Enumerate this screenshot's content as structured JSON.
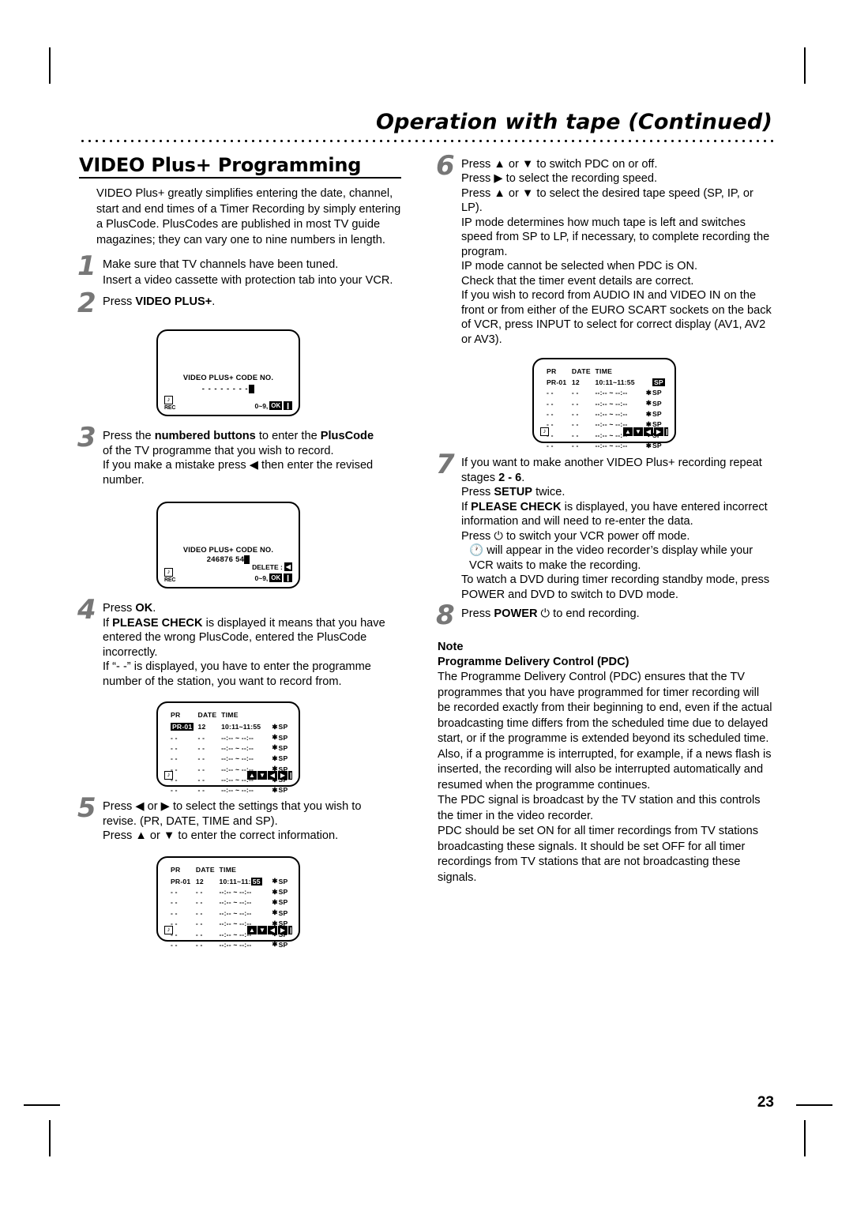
{
  "header": {
    "title": "Operation with tape (Continued)"
  },
  "page_number": "23",
  "left": {
    "section_title": "VIDEO Plus+ Programming",
    "intro": "VIDEO Plus+ greatly simplifies entering the date, channel, start and end times of a Timer Recording by simply entering a PlusCode. PlusCodes are published in most TV guide magazines; they can vary one to nine numbers in length.",
    "step1": {
      "num": "1",
      "line1": "Make sure that TV channels have been tuned.",
      "line2": "Insert a video cassette with protection tab into your VCR."
    },
    "step2": {
      "num": "2",
      "pre": "Press ",
      "bold": "VIDEO PLUS+",
      "post": "."
    },
    "screen1": {
      "title": "VIDEO PLUS+ CODE NO.",
      "dashes": "- - - - - - - -",
      "rec_label": "REC",
      "hint_prefix": "0~9,",
      "hint_key": "OK"
    },
    "step3": {
      "num": "3",
      "l1a": "Press the ",
      "l1b": "numbered buttons",
      "l1c": " to enter the ",
      "l1d": "PlusCode",
      "l2": "of the TV programme that you wish to record.",
      "l3": "If you make a mistake press ◀ then enter the revised",
      "l4": "number."
    },
    "screen2": {
      "title": "VIDEO PLUS+ CODE NO.",
      "code": "246876 54",
      "rec_label": "REC",
      "delete_label": "DELETE :",
      "hint_prefix": "0~9,",
      "hint_key": "OK"
    },
    "step4": {
      "num": "4",
      "l1a": "Press ",
      "l1b": "OK",
      "l1c": ".",
      "l2a": "If ",
      "l2b": "PLEASE CHECK",
      "l2c": " is displayed it means that you have",
      "l3": "entered the wrong PlusCode, entered the PlusCode",
      "l4": "incorrectly.",
      "l5": "If “- -” is displayed, you have to enter the programme",
      "l6": "number of the station, you want to record from."
    },
    "screen3": {
      "headers": [
        "PR",
        "DATE",
        "TIME"
      ],
      "rows": [
        {
          "pr": "PR-01",
          "pr_highlight": true,
          "date": "12",
          "time": "10:11~11:55",
          "ast": "✱",
          "sp": "SP"
        },
        {
          "pr": "- -",
          "pr_highlight": false,
          "date": "- -",
          "time": "--:-- ~ --:--",
          "ast": "✱",
          "sp": "SP"
        },
        {
          "pr": "- -",
          "pr_highlight": false,
          "date": "- -",
          "time": "--:-- ~ --:--",
          "ast": "✱",
          "sp": "SP"
        },
        {
          "pr": "- -",
          "pr_highlight": false,
          "date": "- -",
          "time": "--:-- ~ --:--",
          "ast": "✱",
          "sp": "SP"
        },
        {
          "pr": "- -",
          "pr_highlight": false,
          "date": "- -",
          "time": "--:-- ~ --:--",
          "ast": "✱",
          "sp": "SP"
        },
        {
          "pr": "- -",
          "pr_highlight": false,
          "date": "- -",
          "time": "--:-- ~ --:--",
          "ast": "✱",
          "sp": "SP"
        },
        {
          "pr": "- -",
          "pr_highlight": false,
          "date": "- -",
          "time": "--:-- ~ --:--",
          "ast": "✱",
          "sp": "SP"
        }
      ],
      "navkeys": [
        "▲",
        "▼",
        "◀",
        "▶",
        "❙"
      ]
    },
    "step5": {
      "num": "5",
      "l1": "Press ◀ or ▶ to select the settings that you wish to",
      "l2": "revise. (PR, DATE, TIME and SP).",
      "l3": "Press ▲ or ▼ to enter the correct information."
    },
    "screen4": {
      "headers": [
        "PR",
        "DATE",
        "TIME"
      ],
      "rows": [
        {
          "pr": "PR-01",
          "pr_highlight": false,
          "date": "12",
          "time_pre": "10:11~11:",
          "time_hl": "55",
          "ast": "✱",
          "sp": "SP"
        },
        {
          "pr": "- -",
          "pr_highlight": false,
          "date": "- -",
          "time": "--:-- ~ --:--",
          "ast": "✱",
          "sp": "SP"
        },
        {
          "pr": "- -",
          "pr_highlight": false,
          "date": "- -",
          "time": "--:-- ~ --:--",
          "ast": "✱",
          "sp": "SP"
        },
        {
          "pr": "- -",
          "pr_highlight": false,
          "date": "- -",
          "time": "--:-- ~ --:--",
          "ast": "✱",
          "sp": "SP"
        },
        {
          "pr": "- -",
          "pr_highlight": false,
          "date": "- -",
          "time": "--:-- ~ --:--",
          "ast": "✱",
          "sp": "SP"
        },
        {
          "pr": "- -",
          "pr_highlight": false,
          "date": "- -",
          "time": "--:-- ~ --:--",
          "ast": "✱",
          "sp": "SP"
        },
        {
          "pr": "- -",
          "pr_highlight": false,
          "date": "- -",
          "time": "--:-- ~ --:--",
          "ast": "✱",
          "sp": "SP"
        }
      ],
      "navkeys": [
        "▲",
        "▼",
        "◀",
        "▶",
        "❙"
      ]
    }
  },
  "right": {
    "step6": {
      "num": "6",
      "l1": "Press ▲ or ▼ to switch PDC on or off.",
      "l2": "Press ▶ to select the recording speed.",
      "l3": "Press ▲  or ▼ to select the desired tape speed (SP, IP, or LP).",
      "l4": "IP mode determines how much tape is left and switches speed from SP to LP, if necessary, to  complete recording the program.",
      "l5": "IP mode cannot be selected when PDC is ON.",
      "l6": "Check that the timer event details are correct.",
      "l7": "If you wish to record from AUDIO IN and VIDEO IN on the front or from either of the EURO SCART sockets on the back of VCR, press INPUT to select for correct display (AV1, AV2 or AV3)."
    },
    "screen5": {
      "headers": [
        "PR",
        "DATE",
        "TIME"
      ],
      "rows": [
        {
          "pr": "PR-01",
          "pr_highlight": false,
          "date": "12",
          "time": "10:11~11:55",
          "ast": "",
          "sp": "SP",
          "sp_highlight": true
        },
        {
          "pr": "- -",
          "pr_highlight": false,
          "date": "- -",
          "time": "--:-- ~ --:--",
          "ast": "✱",
          "sp": "SP",
          "sp_highlight": false
        },
        {
          "pr": "- -",
          "pr_highlight": false,
          "date": "- -",
          "time": "--:-- ~ --:--",
          "ast": "✱",
          "sp": "SP",
          "sp_highlight": false
        },
        {
          "pr": "- -",
          "pr_highlight": false,
          "date": "- -",
          "time": "--:-- ~ --:--",
          "ast": "✱",
          "sp": "SP",
          "sp_highlight": false
        },
        {
          "pr": "- -",
          "pr_highlight": false,
          "date": "- -",
          "time": "--:-- ~ --:--",
          "ast": "✱",
          "sp": "SP",
          "sp_highlight": false
        },
        {
          "pr": "- -",
          "pr_highlight": false,
          "date": "- -",
          "time": "--:-- ~ --:--",
          "ast": "✱",
          "sp": "SP",
          "sp_highlight": false
        },
        {
          "pr": "- -",
          "pr_highlight": false,
          "date": "- -",
          "time": "--:-- ~ --:--",
          "ast": "✱",
          "sp": "SP",
          "sp_highlight": false
        }
      ],
      "navkeys": [
        "▲",
        "▼",
        "◀",
        "▶",
        "❙"
      ]
    },
    "step7": {
      "num": "7",
      "l1a": "If you want to make another VIDEO Plus+ recording repeat stages ",
      "l1b": "2 - 6",
      "l1c": ".",
      "l2a": "Press ",
      "l2b": "SETUP",
      "l2c": " twice.",
      "l3a": "If ",
      "l3b": "PLEASE CHECK",
      "l3c": " is displayed, you have entered incorrect information and will need to re-enter the data.",
      "l4": "Press ⏻ to switch your VCR power off mode.",
      "l5": "🕐  will appear in the video recorder’s display while your VCR waits to make the recording.",
      "l6": "To watch a DVD during timer recording standby mode, press POWER and DVD to switch to DVD mode."
    },
    "step8": {
      "num": "8",
      "pre": "Press ",
      "bold": "POWER",
      "post": " ⏻ to end recording."
    },
    "note": {
      "head": "Note",
      "subhead": "Programme Delivery Control (PDC)",
      "p1": "The Programme Delivery Control (PDC) ensures that the TV programmes that you have programmed for timer recording will be recorded exactly from their beginning to end, even if the actual broadcasting time differs from the scheduled time due to delayed start, or if the programme is extended beyond its scheduled time. Also, if a programme is interrupted, for example, if a news flash is inserted, the recording will also be interrupted automatically and resumed when the programme continues.",
      "p2": "The PDC signal is broadcast by the TV station and this controls the timer in the video recorder.",
      "p3": "PDC should be set ON for all timer recordings from TV stations broadcasting these signals. It should be set OFF for all timer recordings from TV stations that are not broadcasting these signals."
    }
  }
}
